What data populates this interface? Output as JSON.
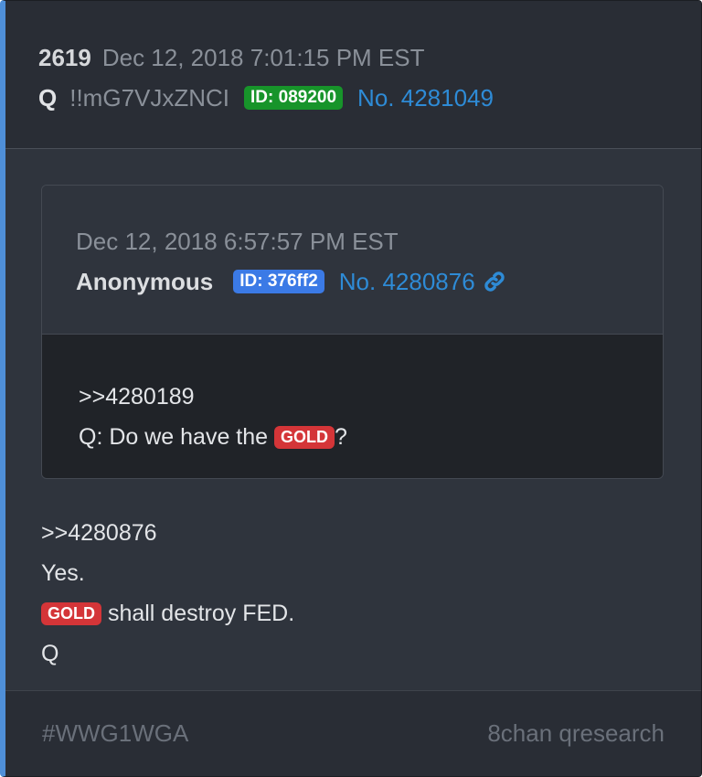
{
  "post": {
    "number": "2619",
    "date": "Dec 12, 2018 7:01:15 PM EST",
    "author": "Q",
    "tripcode": "!!mG7VJxZNCI",
    "id_badge": "ID: 089200",
    "post_no": "No. 4281049"
  },
  "quoted": {
    "date": "Dec 12, 2018 6:57:57 PM EST",
    "author": "Anonymous",
    "id_badge": "ID: 376ff2",
    "post_no": "No. 4280876",
    "link_icon": "link-icon",
    "reply_ref": ">>4280189",
    "text_before": "Q: Do we have the ",
    "highlight": "GOLD",
    "text_after": "?"
  },
  "body": {
    "reply_ref": ">>4280876",
    "line2": "Yes.",
    "highlight": "GOLD",
    "line3_rest": " shall destroy FED.",
    "signature": "Q"
  },
  "footer": {
    "tag": "#WWG1WGA",
    "source": "8chan qresearch"
  },
  "colors": {
    "accent_border": "#4f8fd8",
    "id_badge_green": "#17942a",
    "id_badge_blue": "#3b7ae6",
    "highlight_red": "#d43538",
    "link_blue": "#2e8bd6"
  }
}
